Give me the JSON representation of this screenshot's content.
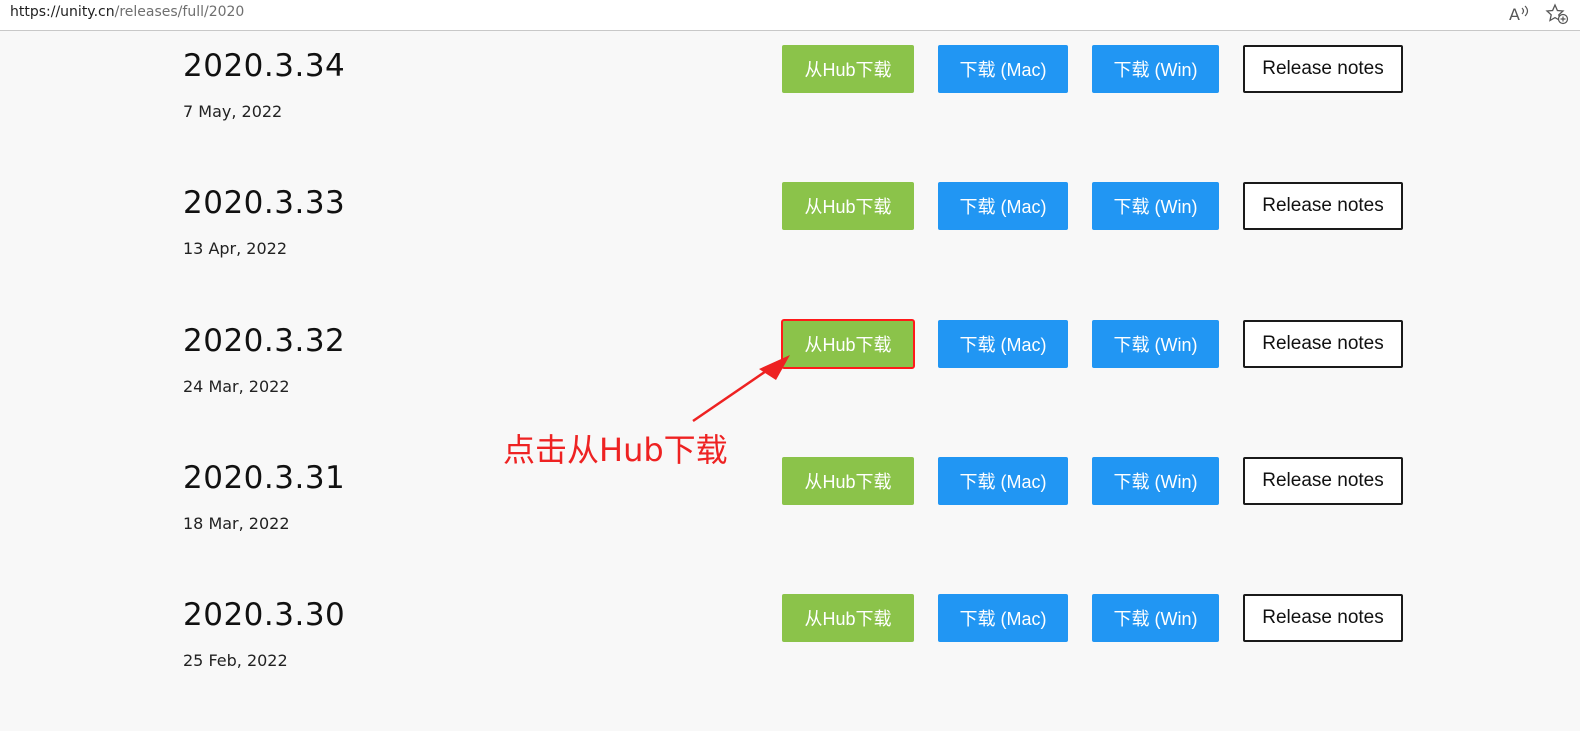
{
  "browser": {
    "url_host": "https://unity.cn",
    "url_path": "/releases/full/2020",
    "toolbar_icons": [
      "read-aloud-icon",
      "add-favorite-icon"
    ]
  },
  "buttons": {
    "hub": "从Hub下载",
    "mac": "下载 (Mac)",
    "win": "下载 (Win)",
    "notes": "Release notes"
  },
  "releases": [
    {
      "version": "2020.3.34",
      "date": "7 May, 2022"
    },
    {
      "version": "2020.3.33",
      "date": "13 Apr, 2022"
    },
    {
      "version": "2020.3.32",
      "date": "24 Mar, 2022"
    },
    {
      "version": "2020.3.31",
      "date": "18 Mar, 2022"
    },
    {
      "version": "2020.3.30",
      "date": "25 Feb, 2022"
    }
  ],
  "annotation": {
    "text": "点击从Hub下载",
    "color": "#ee2222",
    "highlighted_release": "2020.3.32"
  },
  "colors": {
    "hub_button": "#8bc34a",
    "download_button": "#2196f3",
    "notes_border": "#1a1a1a",
    "annotation": "#ee2222"
  }
}
